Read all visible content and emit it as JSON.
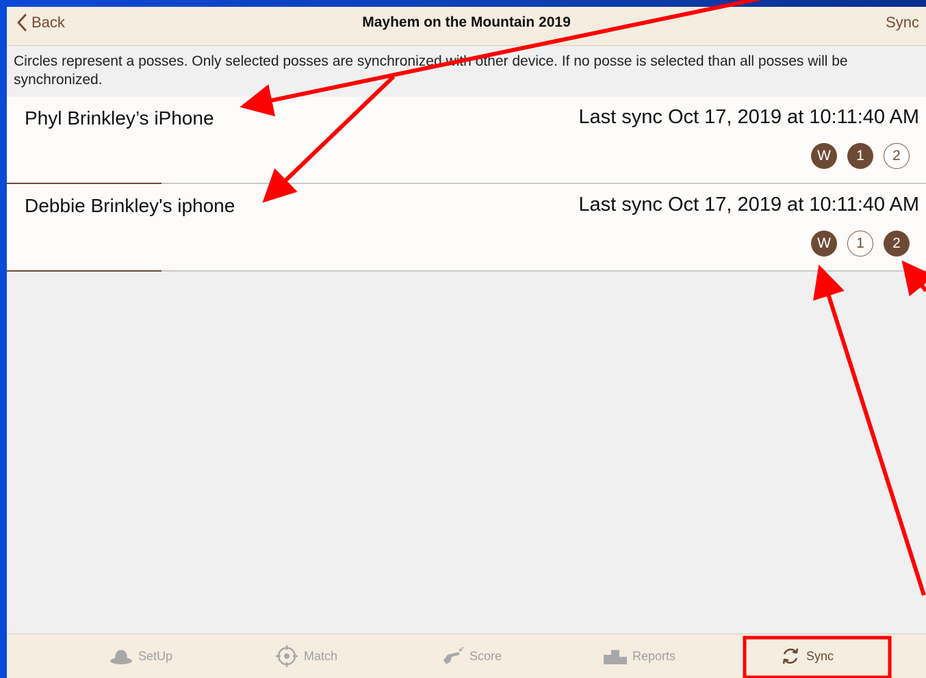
{
  "nav": {
    "back_label": "Back",
    "title": "Mayhem on the Mountain 2019",
    "sync_label": "Sync"
  },
  "info_text": "Circles represent a posses. Only selected posses are synchronized with other device. If no posse is selected than all posses will be synchronized.",
  "devices": [
    {
      "name": "Phyl Brinkley’s iPhone",
      "last_sync": "Last sync Oct 17, 2019 at 10:11:40 AM",
      "posses": [
        {
          "label": "W",
          "selected": true
        },
        {
          "label": "1",
          "selected": true
        },
        {
          "label": "2",
          "selected": false
        }
      ]
    },
    {
      "name": "Debbie Brinkley's iphone",
      "last_sync": "Last sync Oct 17, 2019 at 10:11:40 AM",
      "posses": [
        {
          "label": "W",
          "selected": true
        },
        {
          "label": "1",
          "selected": false
        },
        {
          "label": "2",
          "selected": true
        }
      ]
    }
  ],
  "tabs": [
    {
      "label": "SetUp",
      "icon": "hat-icon",
      "active": false
    },
    {
      "label": "Match",
      "icon": "crosshair-icon",
      "active": false
    },
    {
      "label": "Score",
      "icon": "revolver-icon",
      "active": false
    },
    {
      "label": "Reports",
      "icon": "podium-icon",
      "active": false
    },
    {
      "label": "Sync",
      "icon": "sync-icon",
      "active": true
    }
  ],
  "colors": {
    "brand_brown": "#6d4a35",
    "nav_bg": "#f5ede0",
    "annotation_red": "#ff0000",
    "slide_blue": "#0d3fb0"
  }
}
